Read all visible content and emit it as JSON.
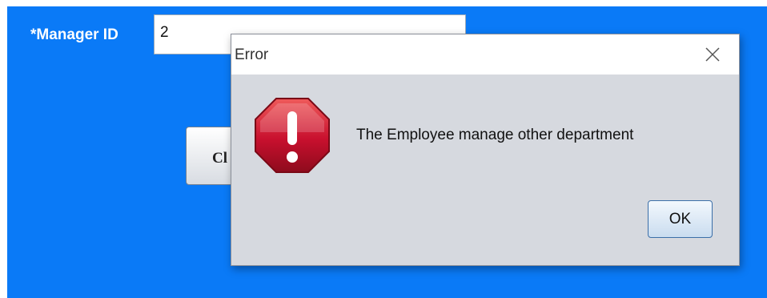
{
  "form": {
    "manager_id_label": "*Manager ID",
    "manager_id_value": "2",
    "partially_hidden_button_label": "Cl"
  },
  "dialog": {
    "title": "Error",
    "message": "The Employee manage other department",
    "ok_label": "OK",
    "icon": "error-stop-icon",
    "close_icon": "close-icon"
  },
  "colors": {
    "background": "#0a7af7",
    "dialog_body": "#d6d9df",
    "error_icon_fill": "#c8102e"
  }
}
